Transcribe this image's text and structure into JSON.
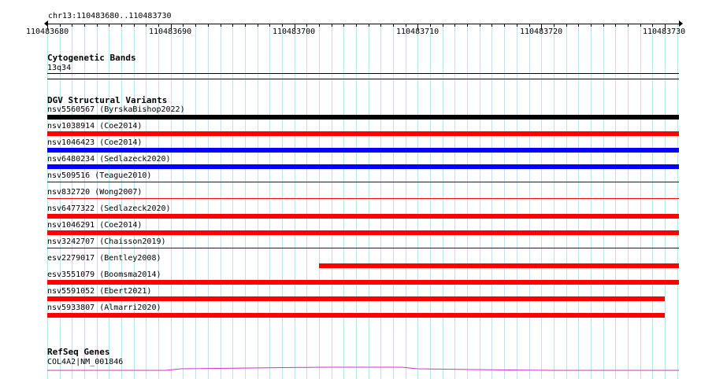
{
  "ruler": {
    "locus": "chr13:110483680..110483730",
    "ticks": [
      "110483680",
      "110483690",
      "110483700",
      "110483710",
      "110483720",
      "110483730"
    ]
  },
  "cytoband_track": {
    "title": "Cytogenetic Bands",
    "band": "13q34"
  },
  "dgv_track": {
    "title": "DGV Structural Variants",
    "features": [
      {
        "label": "nsv5560567 (ByrskaBishop2022)",
        "color": "#000000"
      },
      {
        "label": "nsv1038914 (Coe2014)",
        "color": "#ff0000"
      },
      {
        "label": "nsv1046423 (Coe2014)",
        "color": "#0000ff"
      },
      {
        "label": "nsv6480234 (Sedlazeck2020)",
        "color": "#0000ff"
      },
      {
        "label": "nsv509516 (Teague2010)",
        "color": "#0000ff"
      },
      {
        "label": "nsv832720 (Wong2007)",
        "color": "#ff0000"
      },
      {
        "label": "nsv6477322 (Sedlazeck2020)",
        "color": "#ff0000"
      },
      {
        "label": "nsv1046291 (Coe2014)",
        "color": "#ff0000"
      },
      {
        "label": "nsv3242707 (Chaisson2019)",
        "color": "#0000ff"
      },
      {
        "label": "esv2279017 (Bentley2008)",
        "color": "#ff0000"
      },
      {
        "label": "esv3551079 (Boomsma2014)",
        "color": "#ff0000"
      },
      {
        "label": "nsv5591052 (Ebert2021)",
        "color": "#ff0000"
      },
      {
        "label": "nsv5933807 (Almarri2020)",
        "color": "#ff0000"
      }
    ]
  },
  "refseq_track": {
    "title": "RefSeq Genes",
    "gene": "COL4A2|NM_001846",
    "color": "#cc33cc"
  },
  "colors": {
    "grid": "#bfe3ec",
    "gain": "#0000ff",
    "loss": "#ff0000",
    "complex": "#000000"
  }
}
